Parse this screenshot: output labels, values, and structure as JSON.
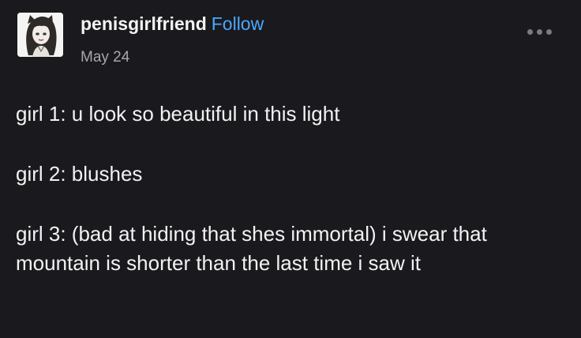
{
  "post": {
    "author": "penisgirlfriend",
    "follow_label": "Follow",
    "date": "May 24",
    "menu_icon": "more-dots-icon",
    "avatar_icon": "avatar-drawing",
    "lines": [
      "girl 1: u look so beautiful in this light",
      "girl 2: blushes",
      "girl 3: (bad at hiding that shes immortal) i swear that mountain is shorter than the last time i saw it"
    ]
  },
  "colors": {
    "background": "#1a191d",
    "text": "#f2f2f2",
    "follow": "#4aa8ff",
    "date": "#a8a8ab"
  }
}
